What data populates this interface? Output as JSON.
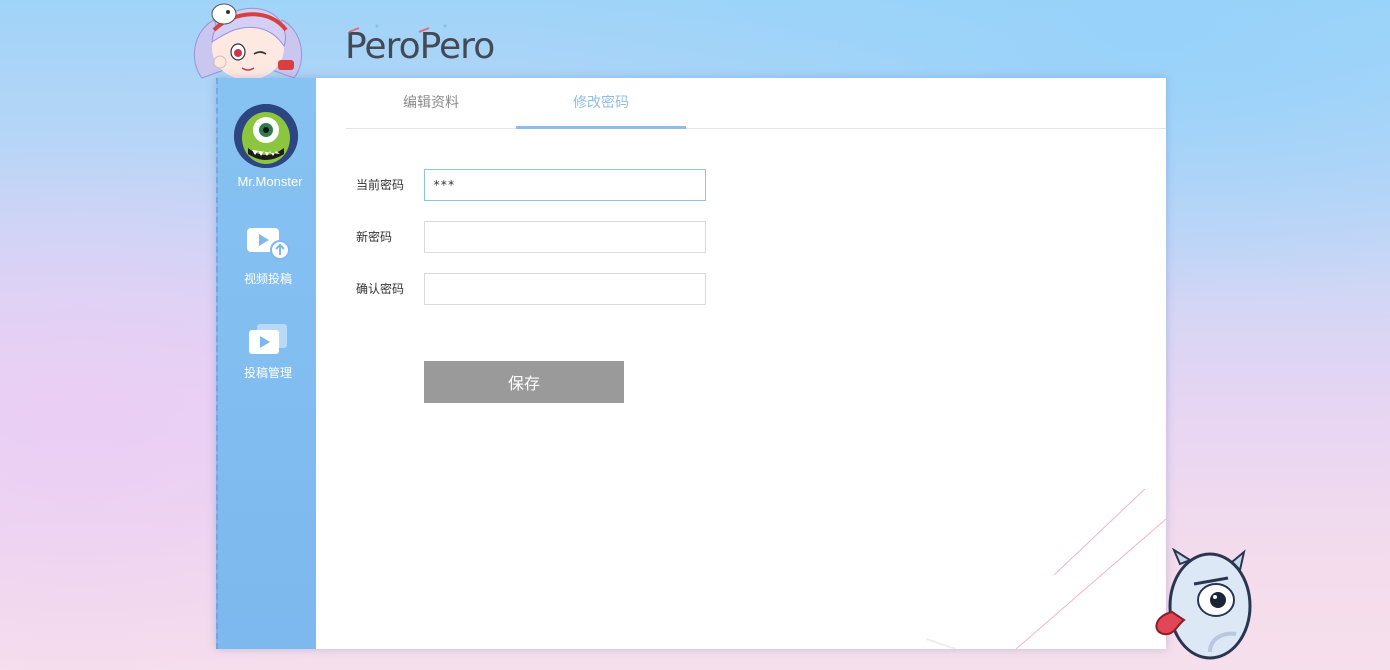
{
  "brand": {
    "logo_text": "PeroPero"
  },
  "sidebar": {
    "username": "Mr.Monster",
    "items": [
      {
        "label": "视频投稿",
        "icon": "video-upload-icon"
      },
      {
        "label": "投稿管理",
        "icon": "video-manage-icon"
      }
    ]
  },
  "tabs": [
    {
      "label": "编辑资料",
      "active": false
    },
    {
      "label": "修改密码",
      "active": true
    }
  ],
  "form": {
    "current_password": {
      "label": "当前密码",
      "value": "***"
    },
    "new_password": {
      "label": "新密码",
      "value": ""
    },
    "confirm_password": {
      "label": "确认密码",
      "value": ""
    },
    "save_label": "保存"
  },
  "colors": {
    "accent": "#8fbde8",
    "sidebar": "#7db8ee",
    "save_button": "#9a9a9a"
  }
}
